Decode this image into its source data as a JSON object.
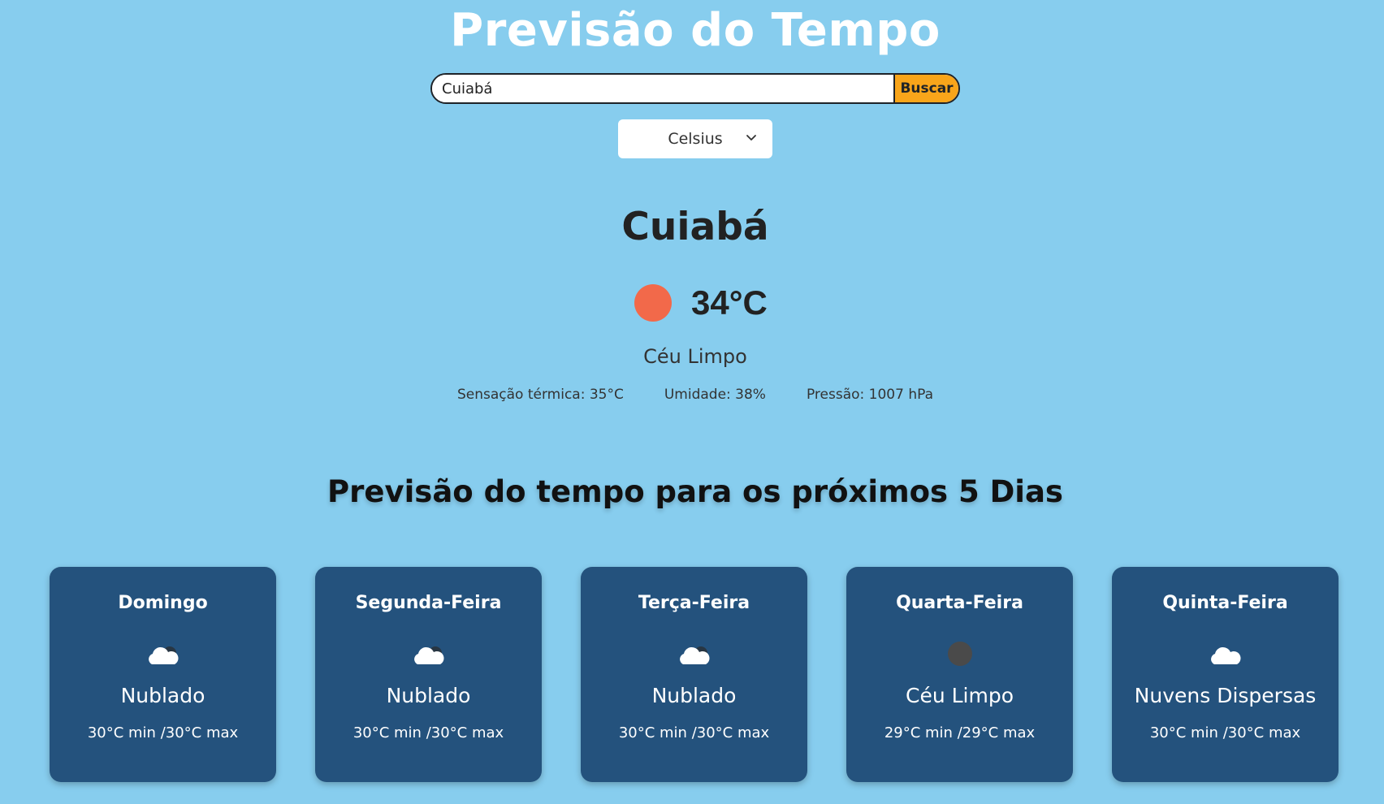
{
  "header": {
    "title": "Previsão do Tempo"
  },
  "search": {
    "value": "Cuiabá",
    "button_label": "Buscar"
  },
  "unit_select": {
    "selected": "Celsius"
  },
  "current": {
    "city": "Cuiabá",
    "temperature": "34°C",
    "condition": "Céu Limpo",
    "feels_like": "Sensação térmica: 35°C",
    "humidity": "Umidade: 38%",
    "pressure": "Pressão: 1007 hPa",
    "icon": "sun-icon",
    "icon_color": "#f2694a"
  },
  "forecast": {
    "title": "Previsão do tempo para os próximos 5 Dias",
    "days": [
      {
        "day": "Domingo",
        "condition": "Nublado",
        "temps": "30°C min /30°C max",
        "icon": "cloud-icon"
      },
      {
        "day": "Segunda-Feira",
        "condition": "Nublado",
        "temps": "30°C min /30°C max",
        "icon": "cloud-icon"
      },
      {
        "day": "Terça-Feira",
        "condition": "Nublado",
        "temps": "30°C min /30°C max",
        "icon": "cloud-icon"
      },
      {
        "day": "Quarta-Feira",
        "condition": "Céu Limpo",
        "temps": "29°C min /29°C max",
        "icon": "moon-icon"
      },
      {
        "day": "Quinta-Feira",
        "condition": "Nuvens Dispersas",
        "temps": "30°C min /30°C max",
        "icon": "cloud-icon"
      }
    ]
  },
  "colors": {
    "background": "#87cdee",
    "card": "#24527d",
    "button": "#f9a51a"
  }
}
